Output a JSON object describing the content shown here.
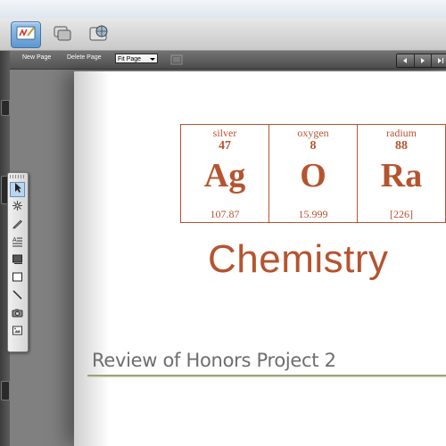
{
  "app_tabs": [
    {
      "name": "whiteboard-tab",
      "icon": "whiteboard-pen-icon",
      "active": true
    },
    {
      "name": "windows-tab",
      "icon": "overlapping-windows-icon",
      "active": false
    },
    {
      "name": "web-tab",
      "icon": "globe-window-icon",
      "active": false
    }
  ],
  "toolbar": {
    "new_page": "New Page",
    "delete_page": "Delete Page",
    "fit_select_value": "Fit Page",
    "nav_icons": [
      "prev-page-icon",
      "next-page-icon",
      "last-page-icon"
    ]
  },
  "slide": {
    "elements": [
      {
        "name": "silver",
        "number": "47",
        "symbol": "Ag",
        "mass": "107.87"
      },
      {
        "name": "oxygen",
        "number": "8",
        "symbol": "O",
        "mass": "15.999"
      },
      {
        "name": "radium",
        "number": "88",
        "symbol": "Ra",
        "mass": "[226]"
      }
    ],
    "title": "Chemistry",
    "subtitle": "Review of Honors Project 2",
    "accent_color": "#b5542f",
    "rule_color": "#9ea37a"
  },
  "palette_tools": [
    "select-arrow-icon",
    "magic-wand-icon",
    "pen-icon",
    "text-lines-icon",
    "fill-rectangle-icon",
    "rectangle-shape-icon",
    "line-icon",
    "camera-icon",
    "picture-icon"
  ]
}
